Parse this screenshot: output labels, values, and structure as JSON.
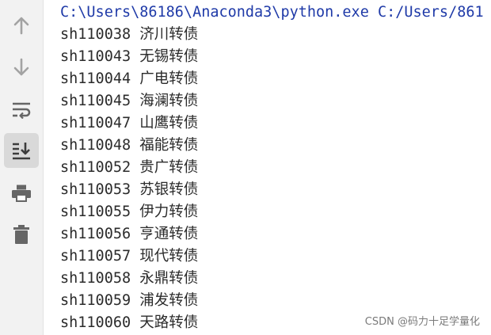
{
  "toolbar": {
    "buttons": [
      {
        "icon": "arrow-up-icon"
      },
      {
        "icon": "arrow-down-icon"
      },
      {
        "icon": "soft-wrap-icon"
      },
      {
        "icon": "scroll-to-end-icon",
        "active": true
      },
      {
        "icon": "print-icon"
      },
      {
        "icon": "trash-icon"
      }
    ]
  },
  "console": {
    "command": "C:\\Users\\86186\\Anaconda3\\python.exe C:/Users/861",
    "lines": [
      "sh110038 济川转债",
      "sh110043 无锡转债",
      "sh110044 广电转债",
      "sh110045 海澜转债",
      "sh110047 山鹰转债",
      "sh110048 福能转债",
      "sh110052 贵广转债",
      "sh110053 苏银转债",
      "sh110055 伊力转债",
      "sh110056 亨通转债",
      "sh110057 现代转债",
      "sh110058 永鼎转债",
      "sh110059 浦发转债",
      "sh110060 天路转债"
    ]
  },
  "watermark": "CSDN @码力十足学量化",
  "colors": {
    "command_text": "#1f3aa8",
    "output_text": "#2b2b2b",
    "toolbar_bg": "#f2f2f2",
    "icon": "#8a8a8a",
    "icon_active": "#3c3c3c"
  }
}
